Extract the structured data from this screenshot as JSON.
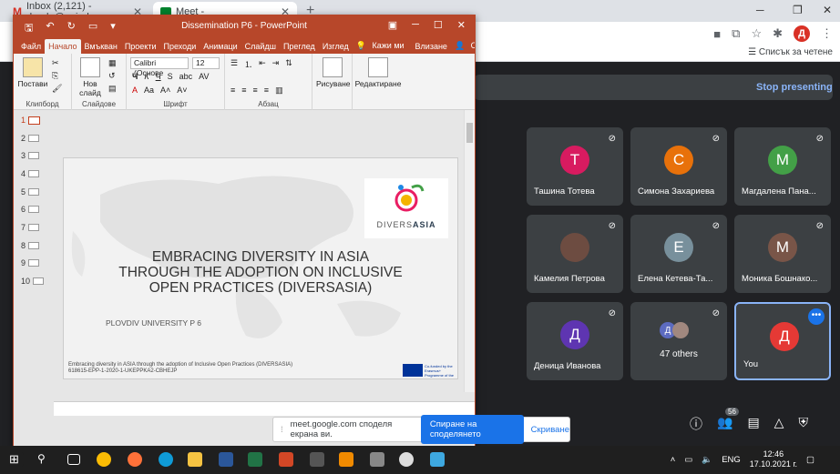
{
  "browser": {
    "tabs": [
      {
        "title": "Inbox (2,121) - doralg@uni-plov",
        "close": "✕"
      },
      {
        "title": "Meet -",
        "close": "✕"
      }
    ],
    "new_tab": "+",
    "reading_list": "Списък за четене",
    "profile_initial": "Д"
  },
  "meet": {
    "stop_presenting": "Stop presenting",
    "participants": [
      {
        "name": "Ташина Тотева",
        "initial": "Т",
        "color": "#d81b60"
      },
      {
        "name": "Симона Захариева",
        "initial": "С",
        "color": "#e8710a"
      },
      {
        "name": "Магдалена Пана...",
        "initial": "М",
        "color": "#43a047"
      },
      {
        "name": "Камелия Петрова",
        "initial": "",
        "color": "#6d4c41"
      },
      {
        "name": "Елена Кетева-Та...",
        "initial": "Е",
        "color": "#78909c"
      },
      {
        "name": "Моника Бошнако...",
        "initial": "М",
        "color": "#795548"
      },
      {
        "name": "Деница Иванова",
        "initial": "Д",
        "color": "#5e35b1"
      }
    ],
    "others": {
      "initial": "Д",
      "label": "47 others"
    },
    "you": {
      "name": "You",
      "initial": "Д",
      "color": "#e53935"
    },
    "people_count": "56"
  },
  "powerpoint": {
    "window_title": "Dissemination P6 - PowerPoint",
    "tabs": [
      "Файл",
      "Начало",
      "Вмъкван",
      "Проекти",
      "Преходи",
      "Анимаци",
      "Слайдш",
      "Преглед",
      "Изглед",
      "Кажи ми",
      "Влизане",
      "Споделяне"
    ],
    "ribbon": {
      "paste": "Постави",
      "new_slide": "Нов слайд",
      "font_name": "Calibri (Основе",
      "font_size": "12",
      "drawing": "Рисуване",
      "editing": "Редактиране",
      "groups": [
        "Клипборд",
        "Слайдове",
        "Шрифт",
        "Абзац"
      ]
    },
    "slide_numbers": [
      "1",
      "2",
      "3",
      "4",
      "5",
      "6",
      "7",
      "8",
      "9",
      "10"
    ],
    "slide": {
      "title_lines": [
        "EMBRACING DIVERSITY IN ASIA",
        "THROUGH THE ADOPTION ON INCLUSIVE",
        "OPEN PRACTICES (DIVERSASIA)"
      ],
      "subtitle": "PLOVDIV UNIVERSITY P 6",
      "footer_line1": "Embracing diversity in ASIA through the adoption of Inclusive Open Practices (DIVERSASIA)",
      "footer_line2": "618615-EPP-1-2020-1-UKEPPKA2-CBHEJP",
      "logo_prefix": "DIVERS",
      "logo_suffix": "ASIA",
      "eu_text": "Co-funded by the Erasmus+ Programme of the European Union"
    }
  },
  "share_bar": {
    "message": "meet.google.com споделя екрана ви.",
    "stop_label": "Спиране на споделянето",
    "hide_label": "Скриване"
  },
  "taskbar": {
    "lang": "ENG",
    "time": "12:46",
    "date": "17.10.2021 г."
  }
}
